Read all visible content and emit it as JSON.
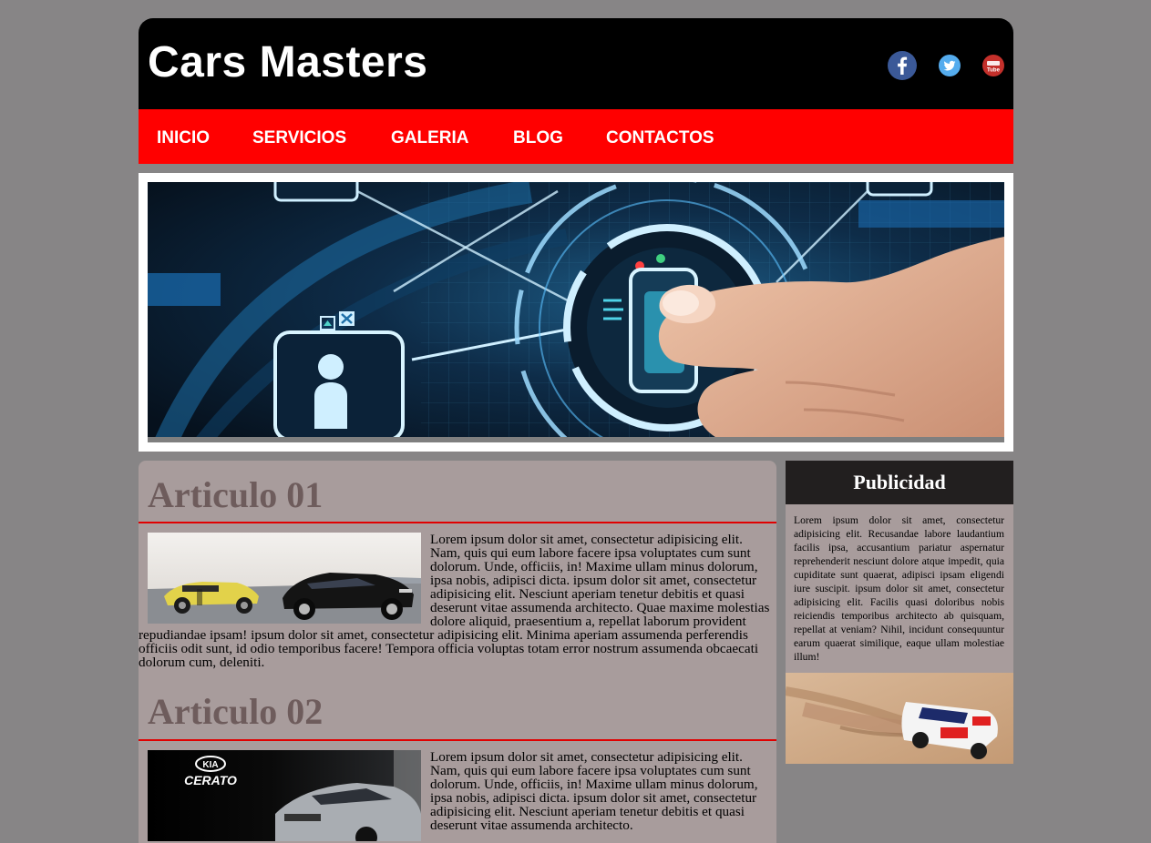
{
  "header": {
    "brand": "Cars Masters",
    "social": [
      "facebook-icon",
      "twitter-icon",
      "youtube-icon"
    ]
  },
  "nav": {
    "items": [
      {
        "label": "INICIO"
      },
      {
        "label": "SERVICIOS"
      },
      {
        "label": "GALERIA"
      },
      {
        "label": "BLOG"
      },
      {
        "label": "CONTACTOS"
      }
    ]
  },
  "articles": [
    {
      "title": "Articulo 01",
      "image": "classic-and-modern-mustang-photo",
      "text": "Lorem ipsum dolor sit amet, consectetur adipisicing elit. Nam, quis qui eum labore facere ipsa voluptates cum sunt dolorum. Unde, officiis, in! Maxime ullam minus dolorum, ipsa nobis, adipisci dicta. ipsum dolor sit amet, consectetur adipisicing elit. Nesciunt aperiam tenetur debitis et quasi deserunt vitae assumenda architecto. Quae maxime molestias dolore aliquid, praesentium a, repellat laborum provident repudiandae ipsam! ipsum dolor sit amet, consectetur adipisicing elit. Minima aperiam assumenda perferendis officiis odit sunt, id odio temporibus facere! Tempora officia voluptas totam error nostrum assumenda obcaecati dolorum cum, deleniti."
    },
    {
      "title": "Articulo 02",
      "image": "kia-cerato-ad-photo",
      "image_brand": "KIA",
      "image_model": "CERATO",
      "text": "Lorem ipsum dolor sit amet, consectetur adipisicing elit. Nam, quis qui eum labore facere ipsa voluptates cum sunt dolorum. Unde, officiis, in! Maxime ullam minus dolorum, ipsa nobis, adipisci dicta. ipsum dolor sit amet, consectetur adipisicing elit. Nesciunt aperiam tenetur debitis et quasi deserunt vitae assumenda architecto."
    }
  ],
  "sidebar": {
    "title": "Publicidad",
    "text": "Lorem ipsum dolor sit amet, consectetur adipisicing elit. Recusandae labore laudantium facilis ipsa, accusantium pariatur aspernatur reprehenderit nesciunt dolore atque impedit, quia cupiditate sunt quaerat, adipisci ipsam eligendi iure suscipit. ipsum dolor sit amet, consectetur adipisicing elit. Facilis quasi doloribus nobis reiciendis temporibus architecto ab quisquam, repellat at veniam? Nihil, incidunt consequuntur earum quaerat similique, eaque ullam molestiae illum!",
    "image": "rally-car-desert-photo"
  },
  "colors": {
    "background": "#878586",
    "header": "#000000",
    "nav": "#ff0000",
    "content": "#a89c9c",
    "heading": "#6e5c5c",
    "rule": "#e00000",
    "ad_title_bg": "#221f1f"
  }
}
